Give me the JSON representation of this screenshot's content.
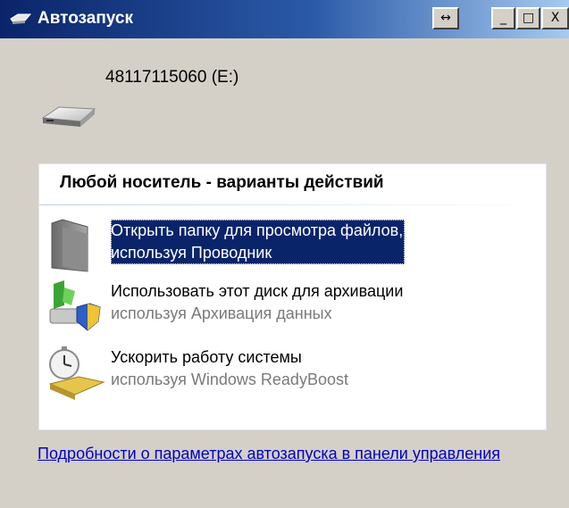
{
  "window": {
    "title": "Автозапуск",
    "controls": {
      "resize": "↔",
      "minimize": "_",
      "maximize": "□",
      "close": "X"
    }
  },
  "device": {
    "label": "48117115060 (E:)"
  },
  "panel": {
    "title": "Любой носитель - варианты действий",
    "options": [
      {
        "title": "Открыть папку для просмотра файлов,",
        "subtitle": "используя Проводник",
        "icon": "folder-icon",
        "selected": true
      },
      {
        "title": "Использовать этот диск для архивации",
        "subtitle": "используя Архивация данных",
        "icon": "backup-icon",
        "selected": false
      },
      {
        "title": "Ускорить работу системы",
        "subtitle": "используя Windows ReadyBoost",
        "icon": "readyboost-icon",
        "selected": false
      }
    ]
  },
  "footer": {
    "link": "Подробности о параметрах автозапуска в панели управления"
  },
  "colors": {
    "titlebar_start": "#0a246a",
    "titlebar_end": "#a6caf0",
    "selection": "#0a246a",
    "link": "#0000cc",
    "window_bg": "#d4d0c8"
  }
}
